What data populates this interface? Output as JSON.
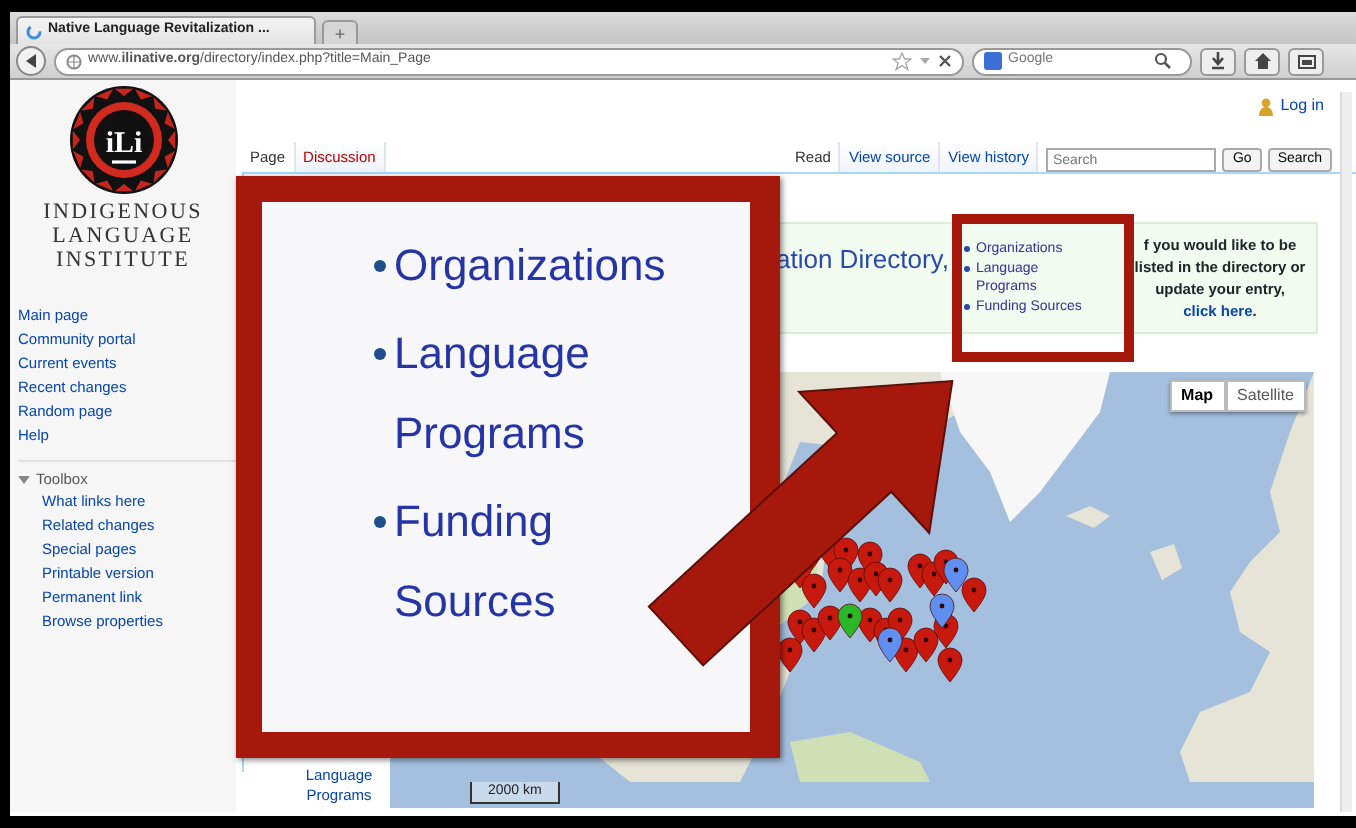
{
  "browser": {
    "tab_title": "Native Language Revitalization ...",
    "new_tab": "+",
    "address": "www.**ilinative.org**/directory/index.php?title=Main_Page",
    "search_placeholder": "Google"
  },
  "site": {
    "logo_text": "iLi",
    "name_lines": [
      "INDIGENOUS",
      "LANGUAGE",
      "INSTITUTE"
    ]
  },
  "sidebar": {
    "navigation": [
      "Main page",
      "Community portal",
      "Current events",
      "Recent changes",
      "Random page",
      "Help"
    ],
    "toolbox": {
      "label": "Toolbox",
      "expanded": true,
      "items": [
        "What links here",
        "Related changes",
        "Special pages",
        "Printable version",
        "Permanent link",
        "Browse properties"
      ]
    }
  },
  "login": "Log in",
  "page_tabs": [
    {
      "label": "Page",
      "selected": true,
      "missing": false
    },
    {
      "label": "Discussion",
      "selected": false,
      "missing": true
    }
  ],
  "view_tabs": [
    {
      "label": "Read",
      "selected": true
    },
    {
      "label": "View source",
      "selected": false
    },
    {
      "label": "View history",
      "selected": false
    }
  ],
  "search": {
    "placeholder": "Search",
    "buttons": [
      "Go",
      "Search"
    ]
  },
  "notice": {
    "heading": "ation Directory,",
    "links": [
      "Organizations",
      "Language Programs",
      "Funding Sources"
    ],
    "message": "f you would like to be listed in the directory or update your entry,",
    "link": "click here",
    "end": "."
  },
  "content_links": [
    "Language Programs"
  ],
  "map": {
    "buttons": [
      {
        "label": "Map",
        "selected": true
      },
      {
        "label": "Satellite",
        "selected": false
      }
    ],
    "scale": "2000 km"
  },
  "callout": {
    "items": [
      "Organizations",
      "Language Programs",
      "Funding Sources"
    ]
  }
}
